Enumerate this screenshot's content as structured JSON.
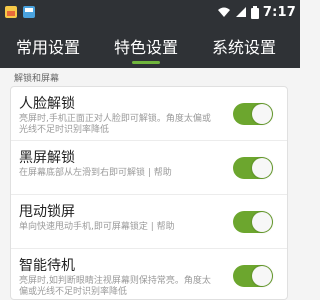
{
  "status_bar": {
    "time": "7:17",
    "icons": [
      "app-icon-1",
      "app-icon-2",
      "wifi-icon",
      "signal-icon",
      "battery-icon"
    ]
  },
  "tabs": [
    {
      "label": "常用设置",
      "active": false
    },
    {
      "label": "特色设置",
      "active": true
    },
    {
      "label": "系统设置",
      "active": false
    }
  ],
  "section": {
    "label": "解锁和屏幕"
  },
  "settings": [
    {
      "title": "人脸解锁",
      "desc": "亮屏时,手机正面正对人脸即可解锁。角度太偏或光线不足时识别率降低",
      "enabled": true
    },
    {
      "title": "黑屏解锁",
      "desc": "在屏幕底部从左滑到右即可解锁 | 帮助",
      "enabled": true
    },
    {
      "title": "甩动锁屏",
      "desc": "单向快速甩动手机,即可屏幕锁定 | 帮助",
      "enabled": true
    },
    {
      "title": "智能待机",
      "desc": "亮屏时,如判断眼睛注视屏幕则保持常亮。角度太偏或光线不足时识别率降低",
      "enabled": true
    }
  ],
  "colors": {
    "accent": "#6ca62e",
    "bar_bg": "#2f3236"
  }
}
